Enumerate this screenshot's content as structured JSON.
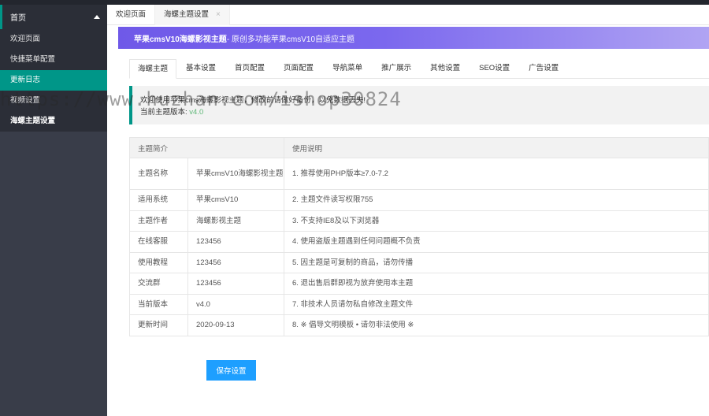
{
  "sidebar": {
    "header": "首页",
    "items": [
      {
        "label": "欢迎页面"
      },
      {
        "label": "快捷菜单配置"
      },
      {
        "label": "更新日志"
      },
      {
        "label": "视频设置"
      },
      {
        "label": "海螺主题设置"
      }
    ]
  },
  "tabs": [
    {
      "label": "欢迎页面"
    },
    {
      "label": "海螺主题设置",
      "close": "×"
    }
  ],
  "banner": {
    "title": "苹果cmsV10海螺影视主题",
    "subtitle": " - 原创多功能苹果cmsV10自适应主题"
  },
  "subtabs": [
    "海螺主题",
    "基本设置",
    "首页配置",
    "页面配置",
    "导航菜单",
    "推广展示",
    "其他设置",
    "SEO设置",
    "广告设置"
  ],
  "notice": {
    "line1": "欢迎使用苹果cms海螺影视主题，修改前请做好备份，以免数据丢失!",
    "version_label": "当前主题版本:",
    "version": "v4.0"
  },
  "table": {
    "headers": [
      "主题简介",
      "",
      "使用说明"
    ],
    "rows": [
      {
        "key": "主题名称",
        "value": "苹果cmsV10海螺影视主题",
        "note": "1. 推荐使用PHP版本≥7.0-7.2"
      },
      {
        "key": "适用系统",
        "value": "苹果cmsV10",
        "note": "2. 主题文件读写权限755"
      },
      {
        "key": "主题作者",
        "value": "海螺影视主题",
        "note": "3. 不支持IE8及以下浏览器"
      },
      {
        "key": "在线客服",
        "value": "123456",
        "note": "4. 使用盗版主题遇到任何问题概不负责"
      },
      {
        "key": "使用教程",
        "value": "123456",
        "note": "5. 因主题是可复制的商品，请勿传播"
      },
      {
        "key": "交流群",
        "value": "123456",
        "note": "6. 退出售后群即视为放弃使用本主题"
      },
      {
        "key": "当前版本",
        "value": "v4.0",
        "note": "7. 非技术人员请勿私自修改主题文件"
      },
      {
        "key": "更新时间",
        "value": "2020-09-13",
        "note": "8. ※ 倡导文明模板 • 请勿非法使用 ※"
      }
    ]
  },
  "save_label": "保存设置",
  "watermark": "https://www.huzhan.com/ishop30824",
  "colors": {
    "accent": "#009688",
    "button": "#1e9fff",
    "sidebar": "#393d49",
    "banner": "#7b68ee"
  }
}
